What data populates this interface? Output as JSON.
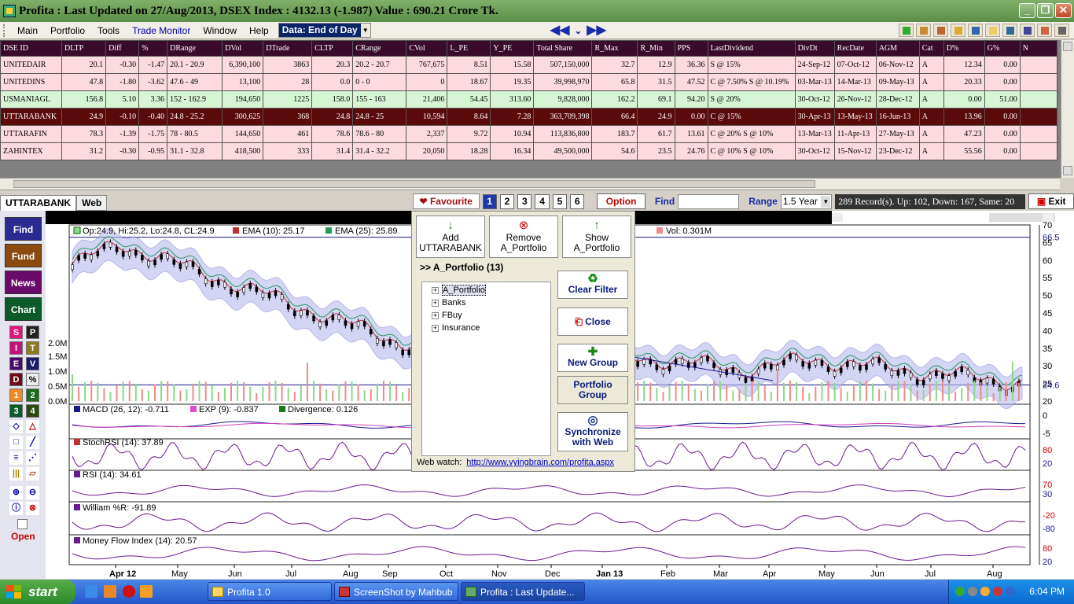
{
  "window": {
    "title": "Profita : Last Updated on 27/Aug/2013,  DSEX Index : 4132.13 (-1.987)  Value : 690.21 Crore Tk."
  },
  "menu": {
    "items": [
      "Main",
      "Portfolio",
      "Tools",
      "Trade Monitor",
      "Window",
      "Help"
    ],
    "data_mode": "Data: End of Day"
  },
  "grid": {
    "columns": [
      "DSE ID",
      "DLTP",
      "Diff",
      "%",
      "DRange",
      "DVol",
      "DTrade",
      "CLTP",
      "CRange",
      "CVol",
      "L_PE",
      "Y_PE",
      "Total Share",
      "R_Max",
      "R_Min",
      "PPS",
      "LastDividend",
      "DivDt",
      "RecDate",
      "AGM",
      "Cat",
      "D%",
      "G%",
      "N"
    ],
    "rows": [
      {
        "style": "pink",
        "cells": [
          "UNITEDAIR",
          "20.1",
          "-0.30",
          "-1.47",
          "20.1 - 20.9",
          "6,390,100",
          "3863",
          "20.3",
          "20.2 - 20.7",
          "767,675",
          "8.51",
          "15.58",
          "507,150,000",
          "32.7",
          "12.9",
          "36.36",
          "S @ 15%",
          "24-Sep-12",
          "07-Oct-12",
          "06-Nov-12",
          "A",
          "12.34",
          "0.00",
          ""
        ]
      },
      {
        "style": "pink",
        "cells": [
          "UNITEDINS",
          "47.8",
          "-1.80",
          "-3.62",
          "47.6 - 49",
          "13,100",
          "28",
          "0.0",
          "0 - 0",
          "0",
          "18.67",
          "19.35",
          "39,998,970",
          "65.8",
          "31.5",
          "47.52",
          "C @ 7.50% S @ 10.19%",
          "03-Mar-13",
          "14-Mar-13",
          "09-May-13",
          "A",
          "20.33",
          "0.00",
          ""
        ]
      },
      {
        "style": "green",
        "cells": [
          "USMANIAGL",
          "156.8",
          "5.10",
          "3.36",
          "152 - 162.9",
          "194,650",
          "1225",
          "158.0",
          "155 - 163",
          "21,406",
          "54.45",
          "313.60",
          "9,828,000",
          "162.2",
          "69.1",
          "94.20",
          "S @ 20%",
          "30-Oct-12",
          "26-Nov-12",
          "28-Dec-12",
          "A",
          "0.00",
          "51.00",
          ""
        ]
      },
      {
        "style": "sel",
        "cells": [
          "UTTARABANK",
          "24.9",
          "-0.10",
          "-0.40",
          "24.8 - 25.2",
          "300,625",
          "368",
          "24.8",
          "24.8 - 25",
          "10,594",
          "8.64",
          "7.28",
          "363,709,398",
          "66.4",
          "24.9",
          "0.00",
          "C @ 15%",
          "30-Apr-13",
          "13-May-13",
          "16-Jun-13",
          "A",
          "13.96",
          "0.00",
          ""
        ]
      },
      {
        "style": "pink",
        "cells": [
          "UTTARAFIN",
          "78.3",
          "-1.39",
          "-1.75",
          "78 - 80.5",
          "144,650",
          "461",
          "78.6",
          "78.6 - 80",
          "2,337",
          "9.72",
          "10.94",
          "113,836,800",
          "183.7",
          "61.7",
          "13.61",
          "C @ 20% S @ 10%",
          "13-Mar-13",
          "11-Apr-13",
          "27-May-13",
          "A",
          "47.23",
          "0.00",
          ""
        ]
      },
      {
        "style": "pink",
        "cells": [
          "ZAHINTEX",
          "31.2",
          "-0.30",
          "-0.95",
          "31.1 - 32.8",
          "418,500",
          "333",
          "31.4",
          "31.4 - 32.2",
          "20,050",
          "18.28",
          "16.34",
          "49,500,000",
          "54.6",
          "23.5",
          "24.76",
          "C @ 10% S @ 10%",
          "30-Oct-12",
          "15-Nov-12",
          "23-Dec-12",
          "A",
          "55.56",
          "0.00",
          ""
        ]
      }
    ]
  },
  "tabs": {
    "symbol": "UTTARABANK",
    "web": "Web"
  },
  "controls": {
    "favourite": "Favourite",
    "pages": [
      "1",
      "2",
      "3",
      "4",
      "5",
      "6"
    ],
    "option": "Option",
    "find_label": "Find",
    "range_label": "Range",
    "range_value": "1.5 Year",
    "status": "289 Record(s). Up: 102, Down: 167, Same: 20",
    "exit": "Exit"
  },
  "left_panel": {
    "buttons": [
      "Find",
      "Fund",
      "News",
      "Chart"
    ],
    "tools": [
      "S",
      "P",
      "I",
      "T",
      "E",
      "V",
      "D",
      "%",
      "1",
      "2",
      "3",
      "4"
    ],
    "open": "Open"
  },
  "chart": {
    "legend_price": "Op:24.9, Hi:25.2, Lo:24.8, CL:24.9",
    "legend_ema10": "EMA (10): 25.17",
    "legend_ema25": "EMA (25): 25.89",
    "legend_vol": "Vol: 0.301M",
    "vol_ticks": [
      "2.0M",
      "1.5M",
      "1.0M",
      "0.5M",
      "0.0M"
    ],
    "price_ticks": [
      "70",
      "65",
      "60",
      "55",
      "50",
      "45",
      "40",
      "35",
      "30",
      "25",
      "20"
    ],
    "price_marker_high": "66.5",
    "price_marker_last": "24.6",
    "macd": "MACD (26, 12): -0.711",
    "exp": "EXP (9): -0.837",
    "divergence": "Divergence: 0.126",
    "macd_ticks": [
      "0",
      "-5"
    ],
    "stochrsi": "StochRSI (14): 37.89",
    "stoch_ticks": [
      "80",
      "20"
    ],
    "rsi": "RSI (14): 34.61",
    "rsi_ticks": [
      "70",
      "30"
    ],
    "william": "William %R: -91.89",
    "will_ticks": [
      "-20",
      "-80"
    ],
    "mfi": "Money Flow Index (14): 20.57",
    "mfi_ticks": [
      "80",
      "20"
    ],
    "months": [
      "Apr 12",
      "May",
      "Jun",
      "Jul",
      "Aug",
      "Sep",
      "Oct",
      "Nov",
      "Dec",
      "Jan 13",
      "Feb",
      "Mar",
      "Apr",
      "May",
      "Jun",
      "Jul",
      "Aug"
    ]
  },
  "popup": {
    "add": "Add UTTARABANK",
    "remove": "Remove A_Portfolio",
    "show": "Show A_Portfolio",
    "portfolio_label": ">> A_Portfolio (13)",
    "tree": [
      "A_Portfolio",
      "Banks",
      "FBuy",
      "Insurance"
    ],
    "clear_filter": "Clear Filter",
    "close": "Close",
    "new_group": "New Group",
    "portfolio_group": "Portfolio Group",
    "sync": "Synchronize with Web",
    "webwatch_label": "Web watch:",
    "webwatch_url": "http://www.vyingbrain.com/profita.aspx"
  },
  "taskbar": {
    "start": "start",
    "tasks": [
      "Profita 1.0",
      "ScreenShot by Mahbub",
      "Profita : Last Update..."
    ],
    "time": "6:04 PM"
  }
}
